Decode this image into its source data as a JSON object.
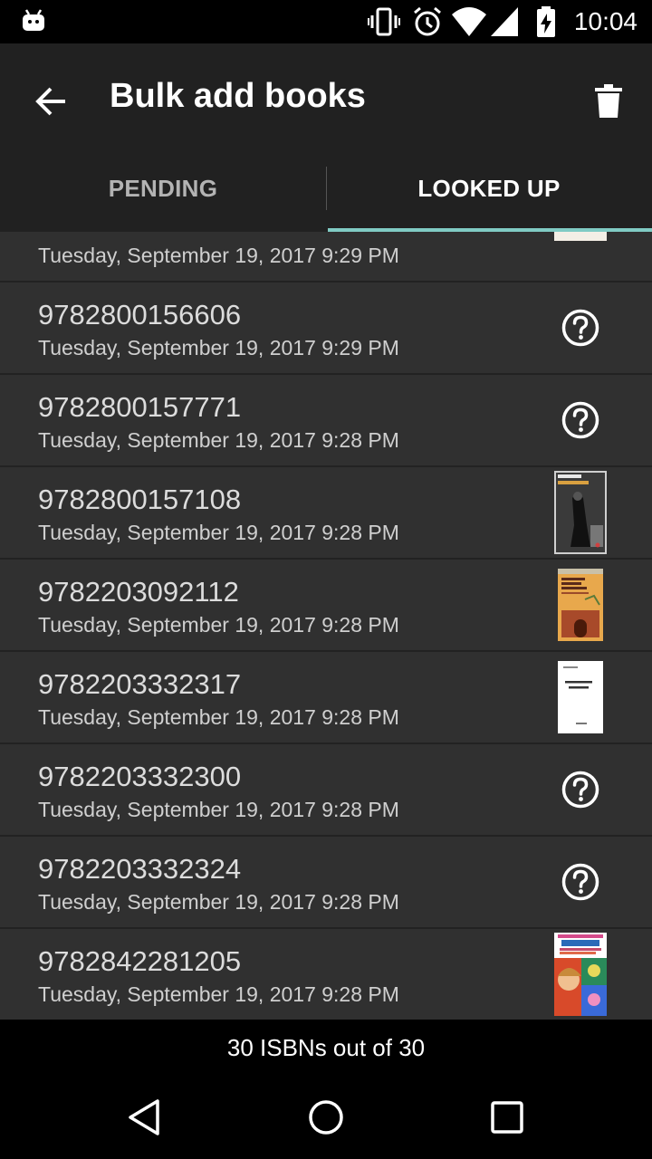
{
  "status_bar": {
    "time": "10:04"
  },
  "app_bar": {
    "title": "Bulk add books"
  },
  "tabs": [
    {
      "label": "PENDING"
    },
    {
      "label": "LOOKED UP"
    }
  ],
  "items": [
    {
      "isbn": "",
      "date": "Tuesday, September 19, 2017 9:29 PM",
      "cover": "cover-illustrated"
    },
    {
      "isbn": "9782800156606",
      "date": "Tuesday, September 19, 2017 9:29 PM",
      "cover": "unknown"
    },
    {
      "isbn": "9782800157771",
      "date": "Tuesday, September 19, 2017 9:28 PM",
      "cover": "unknown"
    },
    {
      "isbn": "9782800157108",
      "date": "Tuesday, September 19, 2017 9:28 PM",
      "cover": "cover-dark"
    },
    {
      "isbn": "9782203092112",
      "date": "Tuesday, September 19, 2017 9:28 PM",
      "cover": "cover-orange"
    },
    {
      "isbn": "9782203332317",
      "date": "Tuesday, September 19, 2017 9:28 PM",
      "cover": "cover-white"
    },
    {
      "isbn": "9782203332300",
      "date": "Tuesday, September 19, 2017 9:28 PM",
      "cover": "unknown"
    },
    {
      "isbn": "9782203332324",
      "date": "Tuesday, September 19, 2017 9:28 PM",
      "cover": "unknown"
    },
    {
      "isbn": "9782842281205",
      "date": "Tuesday, September 19, 2017 9:28 PM",
      "cover": "cover-colorful"
    }
  ],
  "footer": {
    "summary": "30 ISBNs out of 30"
  },
  "colors": {
    "accent": "#80cbc4",
    "app_bar": "#212121",
    "background": "#303030"
  }
}
